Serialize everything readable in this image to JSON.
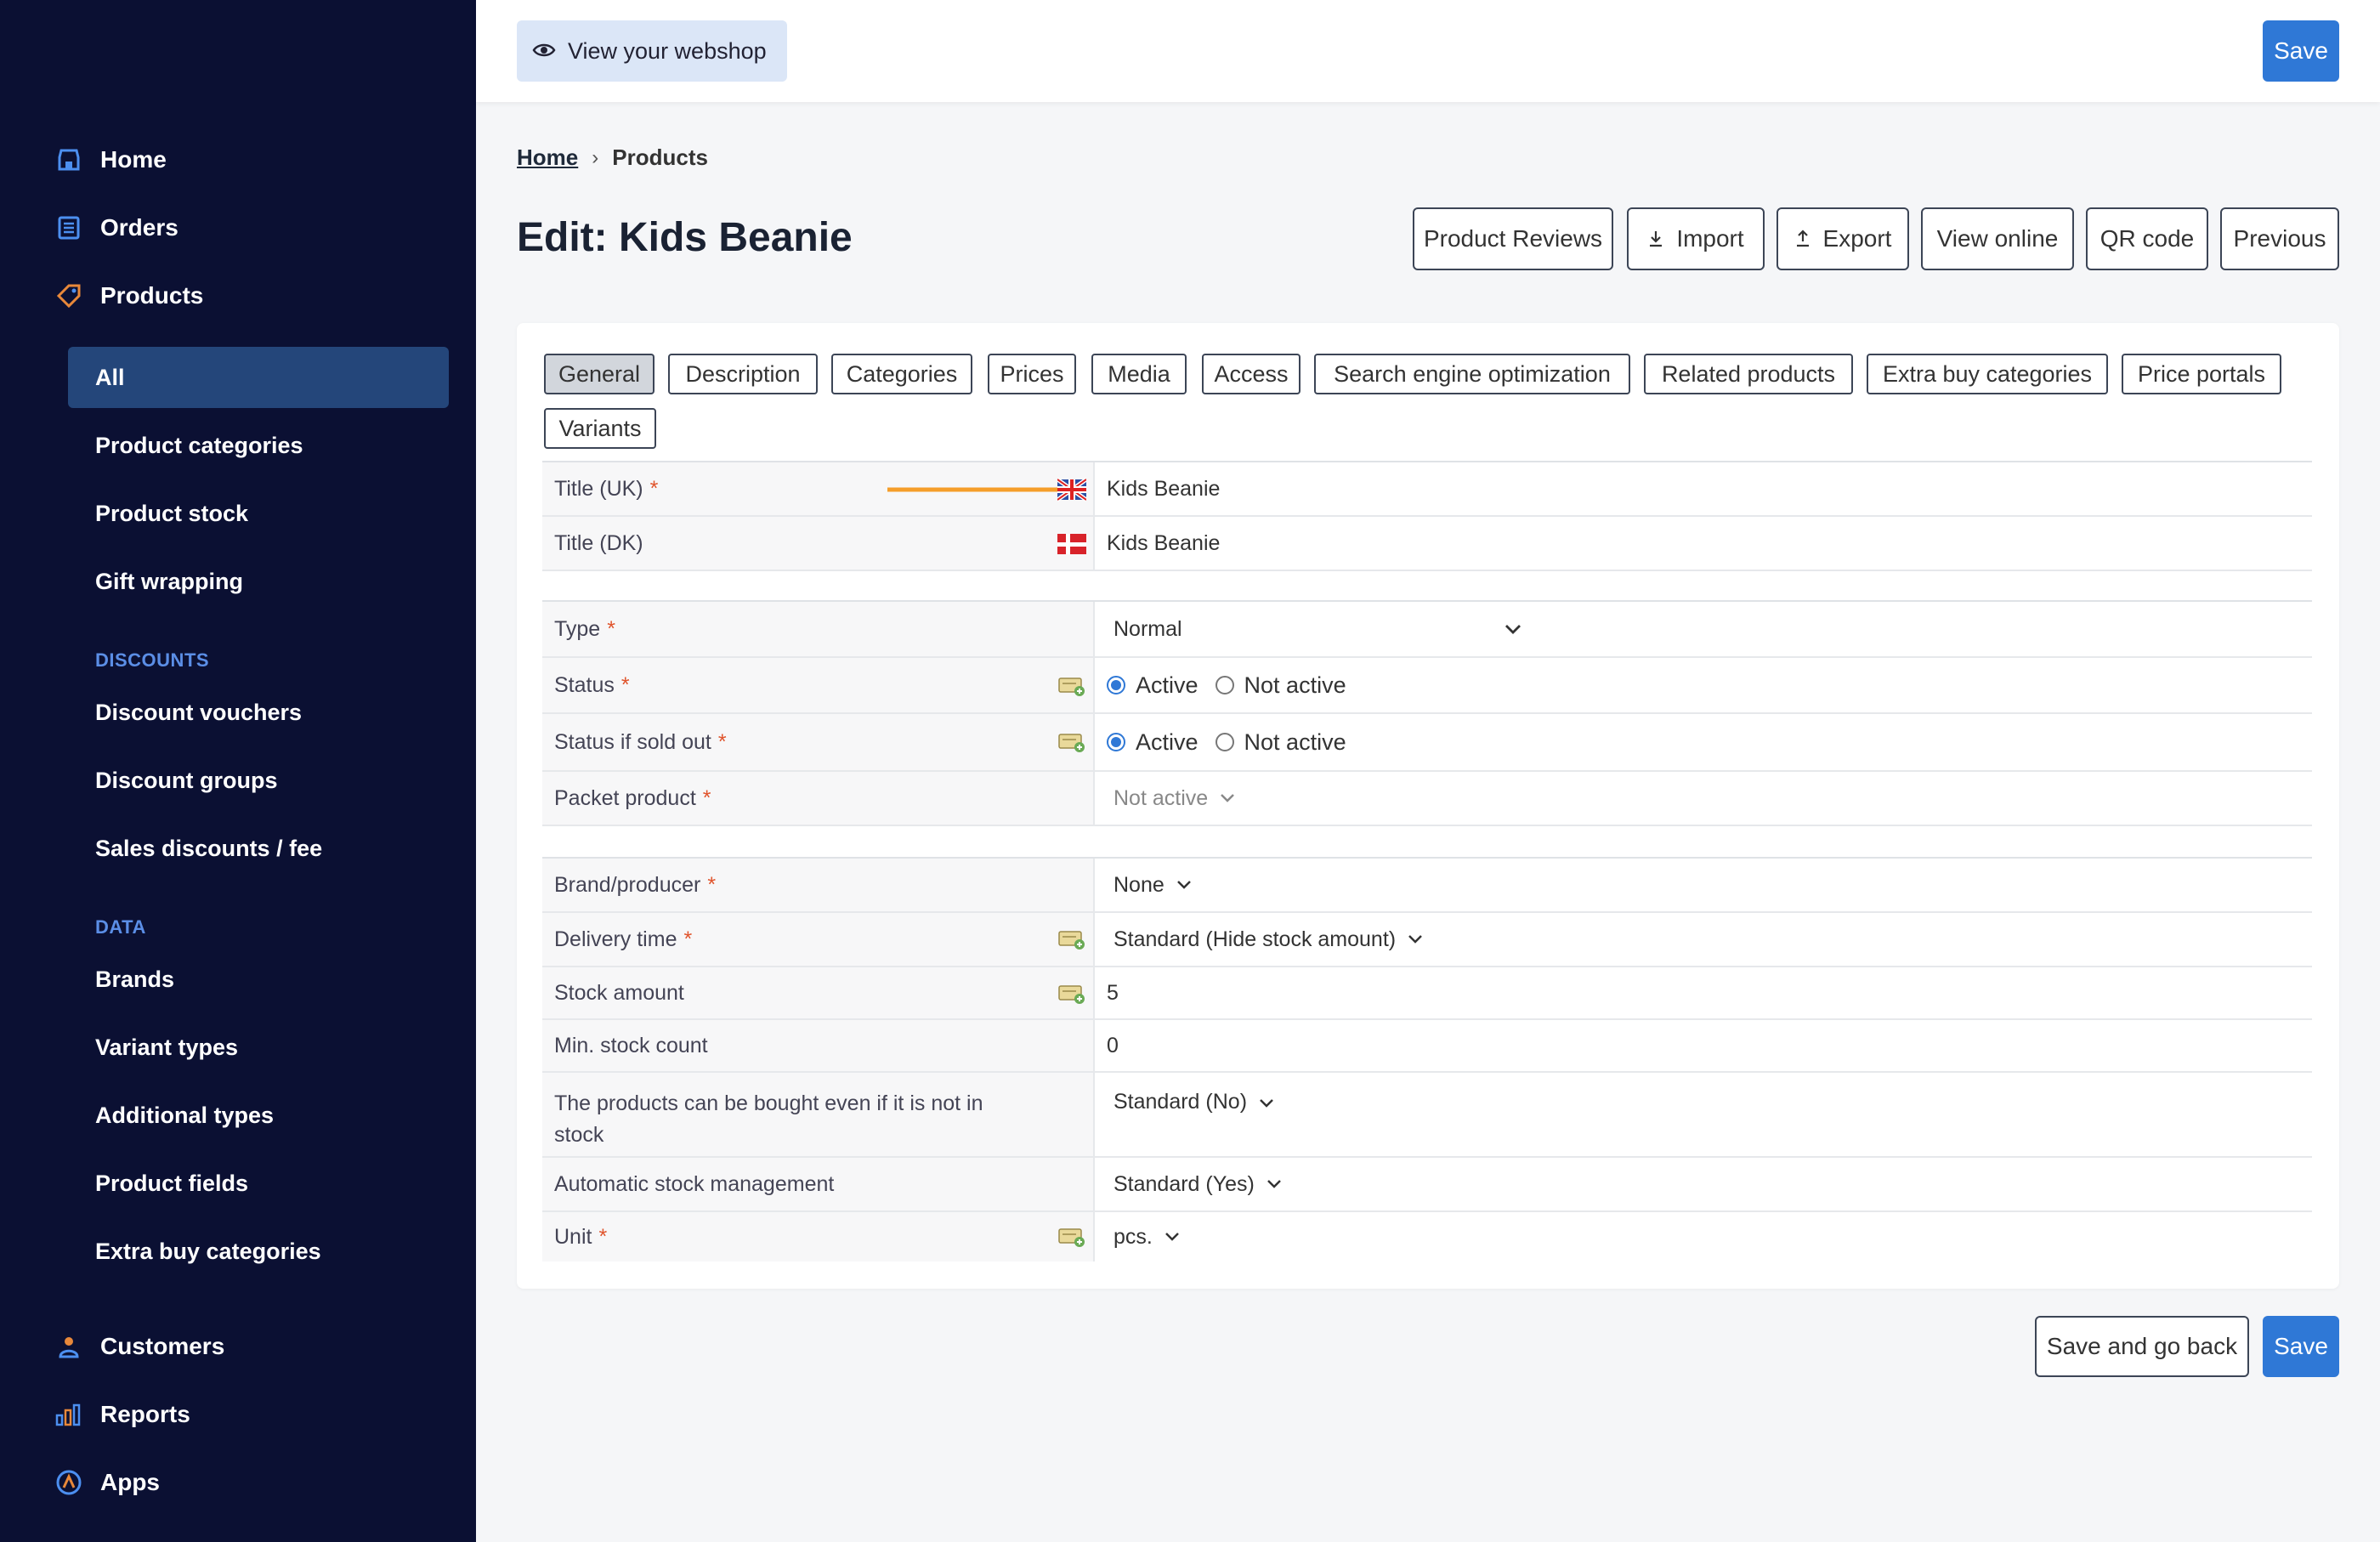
{
  "sidebar": {
    "nav": [
      {
        "label": "Home",
        "icon": "store-icon"
      },
      {
        "label": "Orders",
        "icon": "orders-icon"
      },
      {
        "label": "Products",
        "icon": "tag-icon"
      }
    ],
    "products_sub": [
      "All",
      "Product categories",
      "Product stock",
      "Gift wrapping"
    ],
    "discounts_label": "DISCOUNTS",
    "discounts": [
      "Discount vouchers",
      "Discount groups",
      "Sales discounts / fee"
    ],
    "data_label": "DATA",
    "data": [
      "Brands",
      "Variant types",
      "Additional types",
      "Product fields",
      "Extra buy categories"
    ],
    "bottom_nav": [
      {
        "label": "Customers",
        "icon": "user-icon"
      },
      {
        "label": "Reports",
        "icon": "bar-chart-icon"
      },
      {
        "label": "Apps",
        "icon": "apps-icon"
      }
    ]
  },
  "topbar": {
    "webshop_label": "View your webshop",
    "save_label": "Save"
  },
  "breadcrumb": {
    "home": "Home",
    "current": "Products"
  },
  "page": {
    "title": "Edit: Kids Beanie"
  },
  "header_buttons": [
    "Product Reviews",
    "Import",
    "Export",
    "View online",
    "QR code",
    "Previous"
  ],
  "tabs": [
    "General",
    "Description",
    "Categories",
    "Prices",
    "Media",
    "Access",
    "Search engine optimization",
    "Related products",
    "Extra buy categories",
    "Price portals",
    "Variants"
  ],
  "form": {
    "title_uk": {
      "label": "Title (UK)",
      "value": "Kids Beanie"
    },
    "title_dk": {
      "label": "Title (DK)",
      "value": "Kids Beanie"
    },
    "type": {
      "label": "Type",
      "value": "Normal"
    },
    "status": {
      "label": "Status",
      "opt_active": "Active",
      "opt_inactive": "Not active"
    },
    "status_sold_out": {
      "label": "Status if sold out",
      "opt_active": "Active",
      "opt_inactive": "Not active"
    },
    "packet": {
      "label": "Packet product",
      "value": "Not active"
    },
    "brand": {
      "label": "Brand/producer",
      "value": "None"
    },
    "delivery": {
      "label": "Delivery time",
      "value": "Standard (Hide stock amount)"
    },
    "stock": {
      "label": "Stock amount",
      "value": "5"
    },
    "min_stock": {
      "label": "Min. stock count",
      "value": "0"
    },
    "buy_no_stock": {
      "label": "The products can be bought even if it is not in stock",
      "value": "Standard (No)"
    },
    "auto_stock": {
      "label": "Automatic stock management",
      "value": "Standard (Yes)"
    },
    "unit": {
      "label": "Unit",
      "value": "pcs."
    }
  },
  "footer": {
    "save_back_label": "Save and go back",
    "save_label": "Save"
  },
  "colors": {
    "sidebar_bg": "#0b1033",
    "primary": "#2f78d6",
    "accent_arrow": "#f59e2a",
    "required": "#e0542c"
  }
}
